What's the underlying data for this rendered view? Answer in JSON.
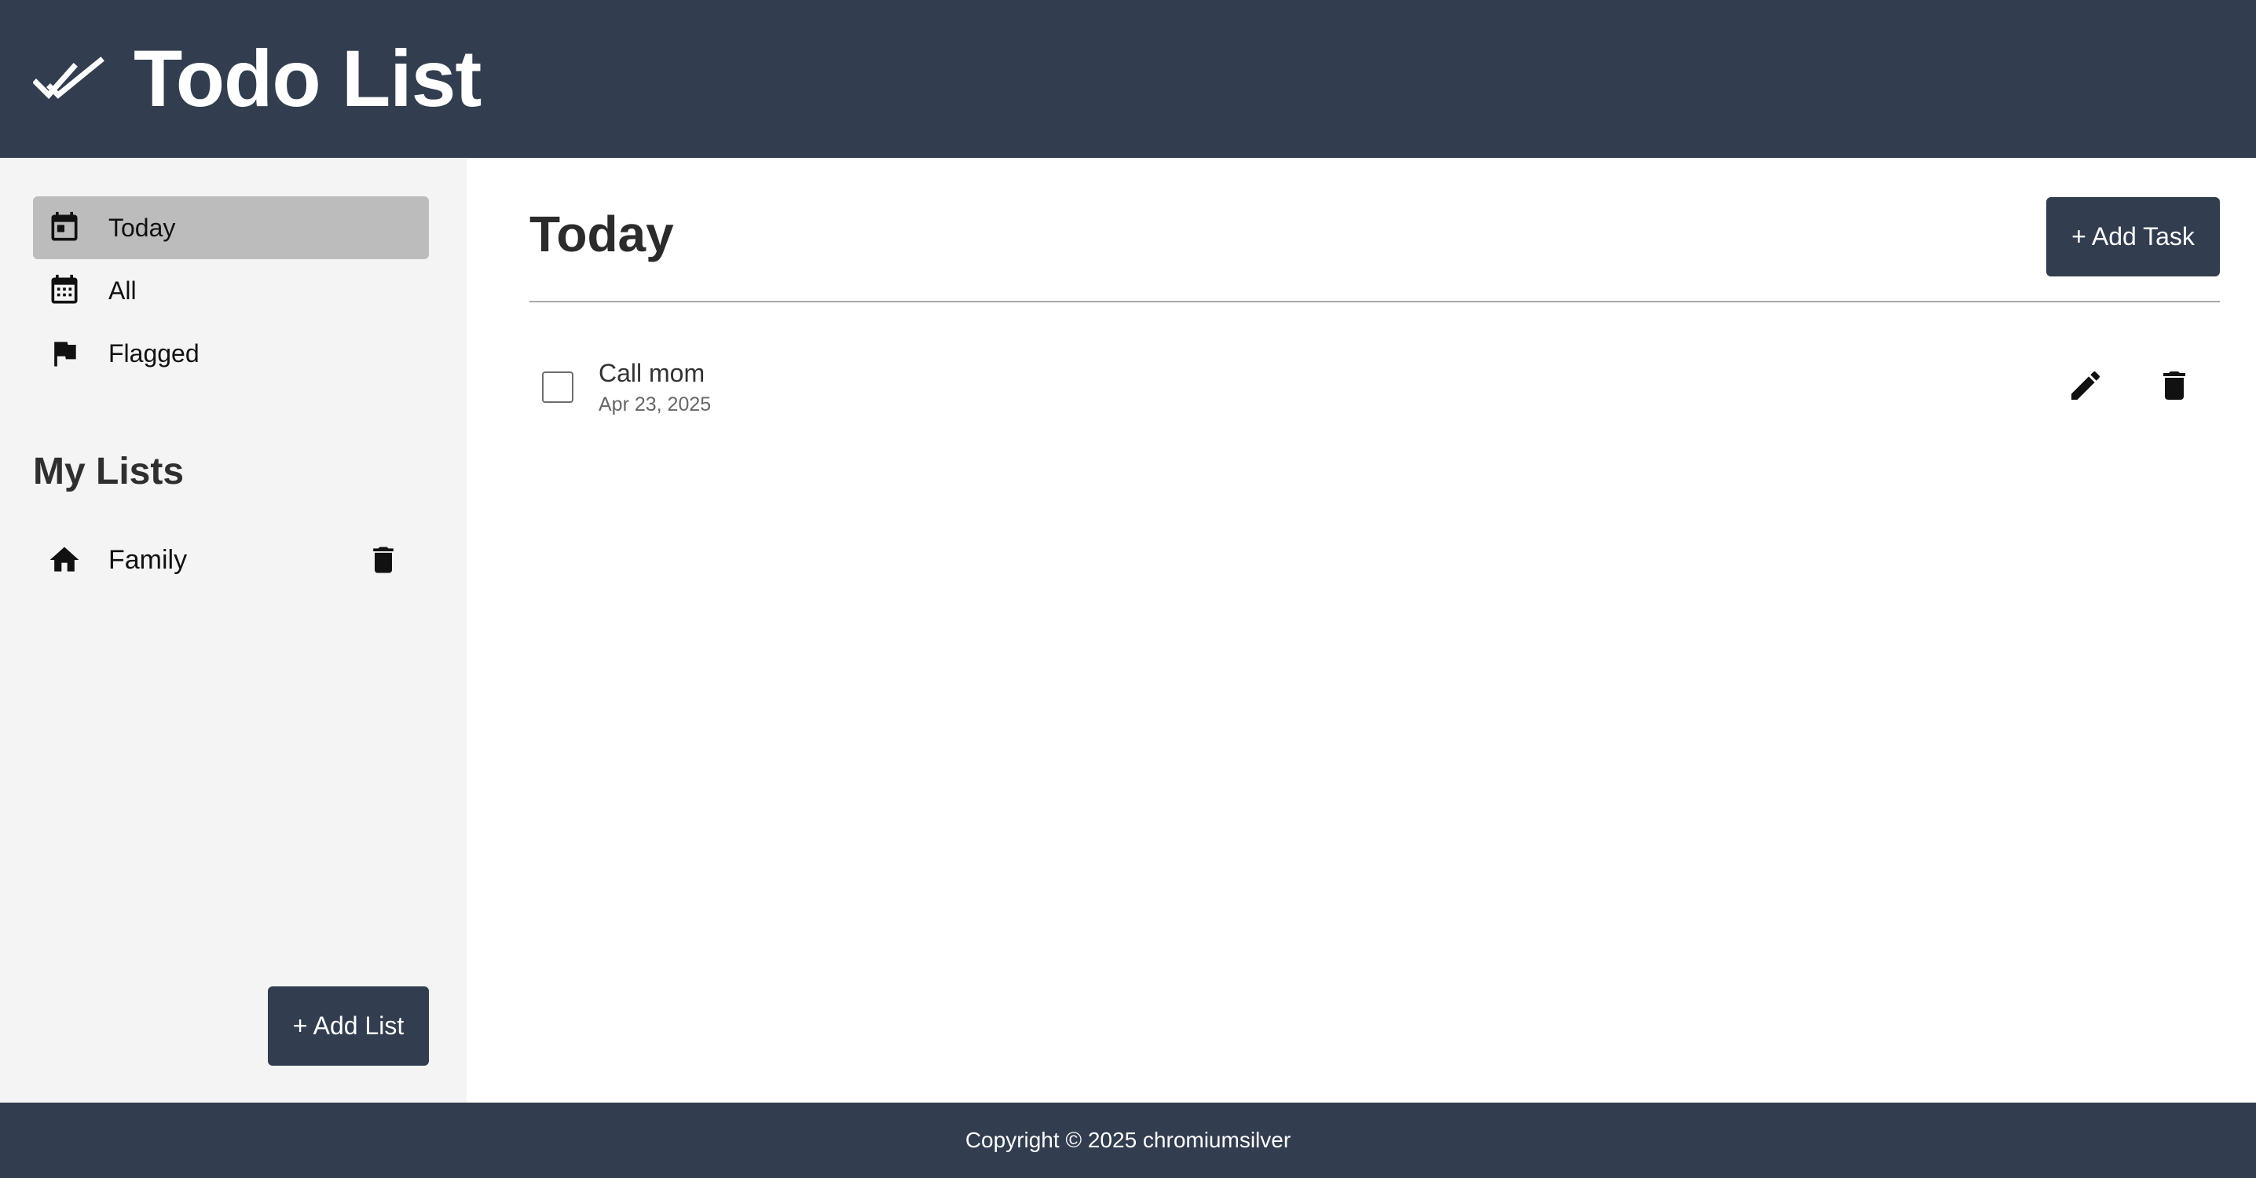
{
  "header": {
    "title": "Todo List",
    "logo_icon": "double-check-icon"
  },
  "colors": {
    "primary": "#323d4f",
    "sidebar_bg": "#f4f4f4",
    "active_item_bg": "#bcbcbc"
  },
  "sidebar": {
    "nav_items": [
      {
        "label": "Today",
        "icon": "calendar-today-icon",
        "active": true
      },
      {
        "label": "All",
        "icon": "calendar-month-icon",
        "active": false
      },
      {
        "label": "Flagged",
        "icon": "flag-icon",
        "active": false
      }
    ],
    "my_lists_title": "My Lists",
    "lists": [
      {
        "label": "Family",
        "icon": "home-icon",
        "delete_icon": "trash-icon"
      }
    ],
    "add_list_label": "+ Add List"
  },
  "main": {
    "title": "Today",
    "add_task_label": "+ Add Task",
    "tasks": [
      {
        "title": "Call mom",
        "date": "Apr 23, 2025",
        "completed": false,
        "edit_icon": "pencil-icon",
        "delete_icon": "trash-icon"
      }
    ]
  },
  "footer": {
    "copyright": "Copyright © 2025 chromiumsilver"
  }
}
